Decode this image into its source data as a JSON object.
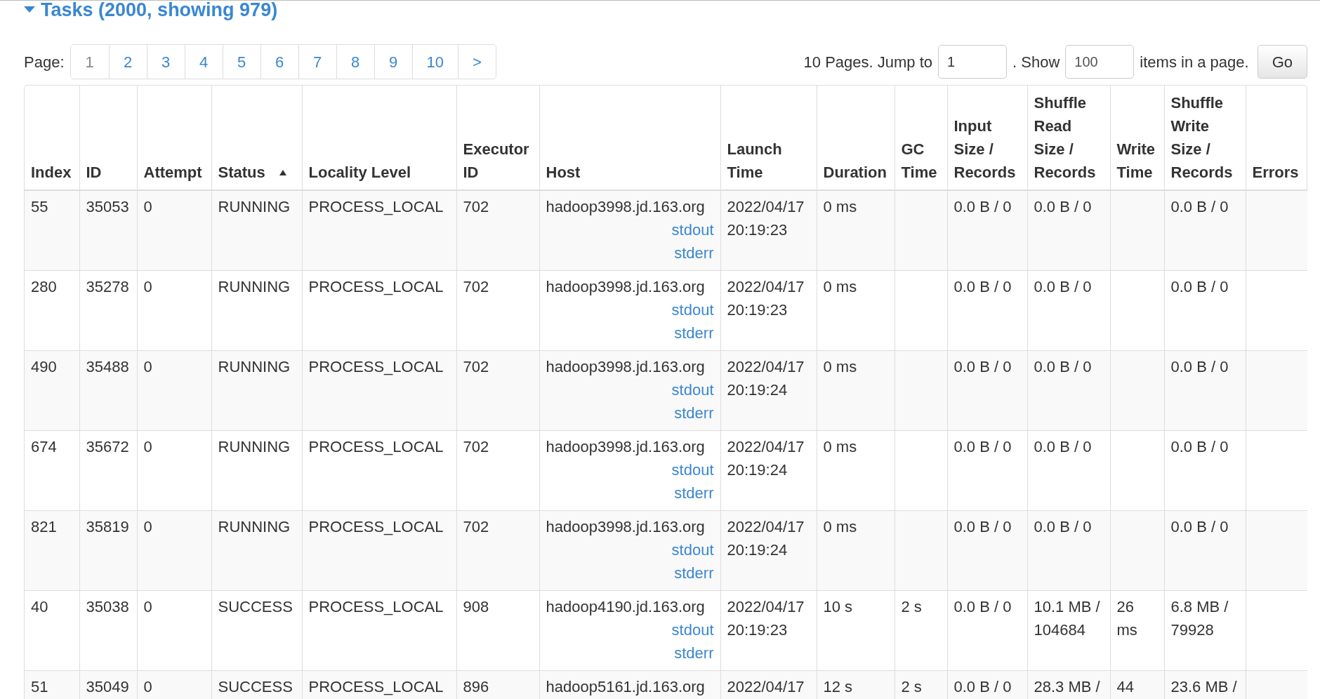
{
  "section": {
    "title": "Tasks (2000, showing 979)",
    "expanded": true
  },
  "pagination": {
    "label": "Page:",
    "pages": [
      {
        "label": "1",
        "selected": true
      },
      {
        "label": "2",
        "selected": false
      },
      {
        "label": "3",
        "selected": false
      },
      {
        "label": "4",
        "selected": false
      },
      {
        "label": "5",
        "selected": false
      },
      {
        "label": "6",
        "selected": false
      },
      {
        "label": "7",
        "selected": false
      },
      {
        "label": "8",
        "selected": false
      },
      {
        "label": "9",
        "selected": false
      },
      {
        "label": "10",
        "selected": false
      },
      {
        "label": ">",
        "selected": false
      }
    ],
    "total_text": "10 Pages. Jump to",
    "jump_value": "1",
    "show_text": ". Show",
    "show_value": "100",
    "items_text": "items in a page.",
    "go_button": "Go"
  },
  "table": {
    "columns": [
      {
        "label": "Index",
        "sorted": false
      },
      {
        "label": "ID",
        "sorted": false
      },
      {
        "label": "Attempt",
        "sorted": false
      },
      {
        "label": "Status",
        "sorted": true
      },
      {
        "label": "Locality Level",
        "sorted": false
      },
      {
        "label": "Executor ID",
        "sorted": false
      },
      {
        "label": "Host",
        "sorted": false
      },
      {
        "label": "Launch Time",
        "sorted": false
      },
      {
        "label": "Duration",
        "sorted": false
      },
      {
        "label": "GC Time",
        "sorted": false
      },
      {
        "label": "Input Size / Records",
        "sorted": false
      },
      {
        "label": "Shuffle Read Size / Records",
        "sorted": false
      },
      {
        "label": "Write Time",
        "sorted": false
      },
      {
        "label": "Shuffle Write Size / Records",
        "sorted": false
      },
      {
        "label": "Errors",
        "sorted": false
      }
    ],
    "rows": [
      {
        "cells": [
          "55",
          "35053",
          "0",
          "RUNNING",
          "PROCESS_LOCAL",
          "702",
          "hadoop3998.jd.163.org",
          "2022/04/17 20:19:23",
          "0 ms",
          "",
          "0.0 B / 0",
          "0.0 B / 0",
          "",
          "0.0 B / 0",
          ""
        ],
        "links": [
          "stdout",
          "stderr"
        ]
      },
      {
        "cells": [
          "280",
          "35278",
          "0",
          "RUNNING",
          "PROCESS_LOCAL",
          "702",
          "hadoop3998.jd.163.org",
          "2022/04/17 20:19:23",
          "0 ms",
          "",
          "0.0 B / 0",
          "0.0 B / 0",
          "",
          "0.0 B / 0",
          ""
        ],
        "links": [
          "stdout",
          "stderr"
        ]
      },
      {
        "cells": [
          "490",
          "35488",
          "0",
          "RUNNING",
          "PROCESS_LOCAL",
          "702",
          "hadoop3998.jd.163.org",
          "2022/04/17 20:19:24",
          "0 ms",
          "",
          "0.0 B / 0",
          "0.0 B / 0",
          "",
          "0.0 B / 0",
          ""
        ],
        "links": [
          "stdout",
          "stderr"
        ]
      },
      {
        "cells": [
          "674",
          "35672",
          "0",
          "RUNNING",
          "PROCESS_LOCAL",
          "702",
          "hadoop3998.jd.163.org",
          "2022/04/17 20:19:24",
          "0 ms",
          "",
          "0.0 B / 0",
          "0.0 B / 0",
          "",
          "0.0 B / 0",
          ""
        ],
        "links": [
          "stdout",
          "stderr"
        ]
      },
      {
        "cells": [
          "821",
          "35819",
          "0",
          "RUNNING",
          "PROCESS_LOCAL",
          "702",
          "hadoop3998.jd.163.org",
          "2022/04/17 20:19:24",
          "0 ms",
          "",
          "0.0 B / 0",
          "0.0 B / 0",
          "",
          "0.0 B / 0",
          ""
        ],
        "links": [
          "stdout",
          "stderr"
        ]
      },
      {
        "cells": [
          "40",
          "35038",
          "0",
          "SUCCESS",
          "PROCESS_LOCAL",
          "908",
          "hadoop4190.jd.163.org",
          "2022/04/17 20:19:23",
          "10 s",
          "2 s",
          "0.0 B / 0",
          "10.1 MB / 104684",
          "26 ms",
          "6.8 MB / 79928",
          ""
        ],
        "links": [
          "stdout",
          "stderr"
        ]
      },
      {
        "cells": [
          "51",
          "35049",
          "0",
          "SUCCESS",
          "PROCESS_LOCAL",
          "896",
          "hadoop5161.jd.163.org",
          "2022/04/17",
          "12 s",
          "2 s",
          "0.0 B / 0",
          "28.3 MB /",
          "44",
          "23.6 MB /",
          ""
        ]
      }
    ]
  }
}
